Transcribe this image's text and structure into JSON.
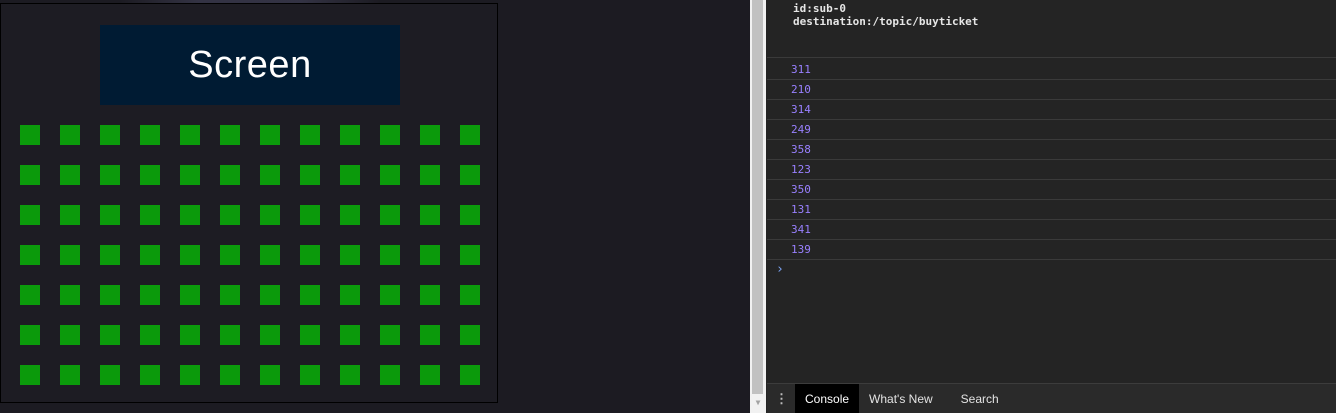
{
  "theater": {
    "screen_label": "Screen",
    "seat_rows": 7,
    "seat_columns": 12,
    "seat_color": "#0b9a0b",
    "screen_color": "#001b33"
  },
  "console": {
    "frame_lines": [
      "id:sub-0",
      "destination:/topic/buyticket"
    ],
    "log_values": [
      "311",
      "210",
      "314",
      "249",
      "358",
      "123",
      "350",
      "131",
      "341",
      "139"
    ],
    "prompt_symbol": "›",
    "log_color": "#9980ff"
  },
  "drawer": {
    "menu_icon": "kebab-icon",
    "tabs": [
      {
        "label": "Console",
        "active": true
      },
      {
        "label": "What's New",
        "active": false
      },
      {
        "label": "Search",
        "active": false
      }
    ]
  }
}
